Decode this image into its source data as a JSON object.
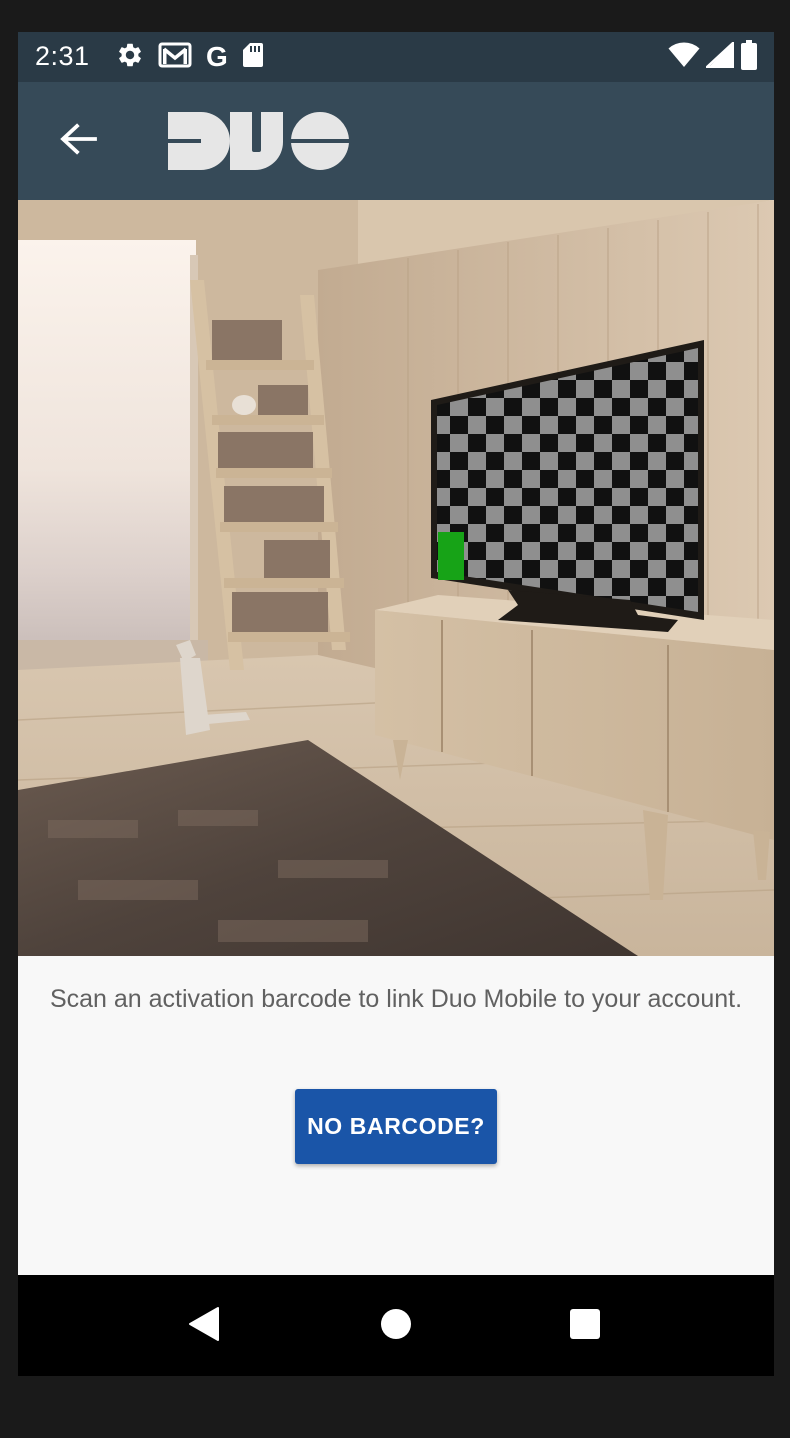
{
  "status_bar": {
    "time": "2:31",
    "left_icons": [
      "settings-icon",
      "gmail-icon",
      "google-icon",
      "sd-card-icon"
    ],
    "google_letter": "G",
    "right_icons": [
      "wifi-icon",
      "cell-signal-icon",
      "battery-icon"
    ]
  },
  "app_bar": {
    "back_icon": "arrow-left-icon",
    "logo_text": "DUO",
    "color": "#364a58"
  },
  "main": {
    "illustration_icon": "room-with-tv-checkerboard-illustration",
    "instruction": "Scan an activation barcode to link Duo Mobile to your account.",
    "button_label": "NO BARCODE?",
    "button_color": "#1a55a8"
  },
  "nav_bar": {
    "icons": [
      "back-triangle-icon",
      "home-circle-icon",
      "recents-square-icon"
    ]
  }
}
